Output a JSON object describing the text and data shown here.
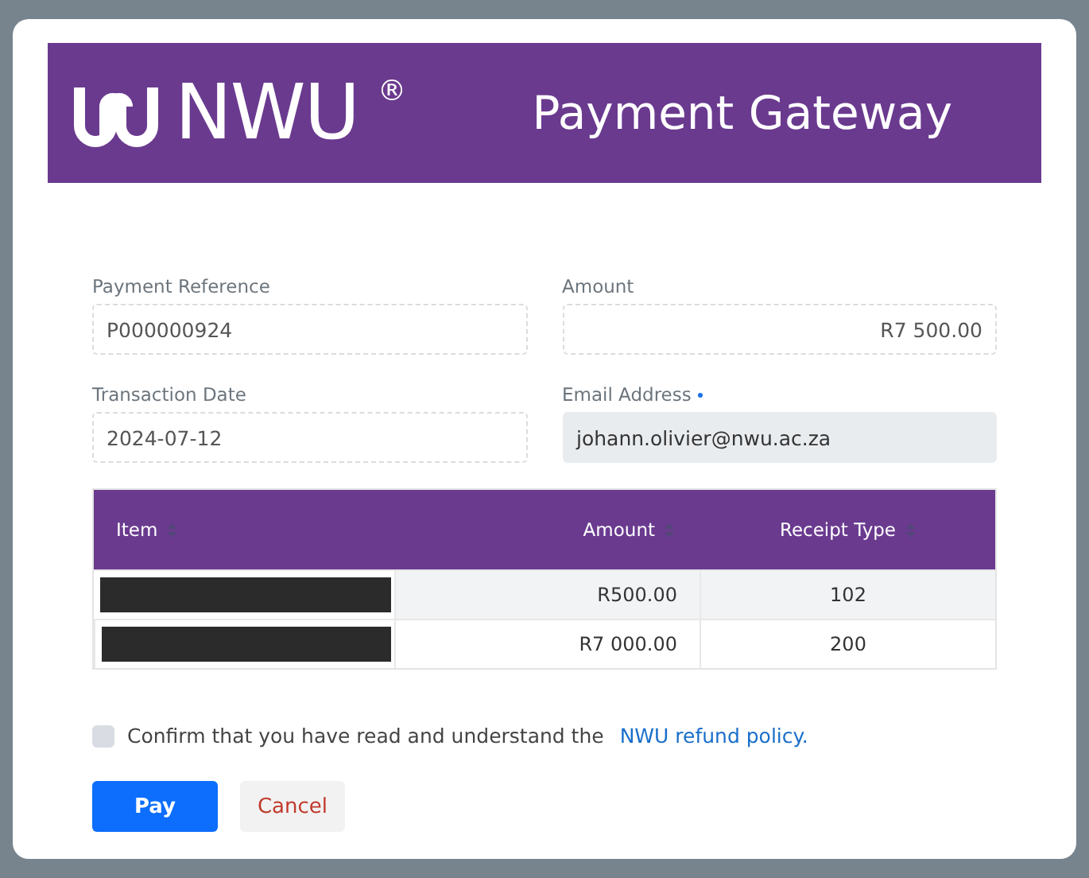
{
  "header": {
    "logo_text": "NWU",
    "logo_mark": "®",
    "title": "Payment Gateway"
  },
  "fields": [
    {
      "label": "Payment Reference",
      "value": "P000000924",
      "disabled": false,
      "required": false
    },
    {
      "label": "Amount",
      "value": "R7 500.00",
      "disabled": false,
      "required": false
    },
    {
      "label": "Transaction Date",
      "value": "2024-07-12",
      "disabled": false,
      "required": false
    },
    {
      "label": "Email Address",
      "value": "johann.olivier@nwu.ac.za",
      "disabled": true,
      "required": true
    }
  ],
  "table": {
    "columns": [
      {
        "label": "Item"
      },
      {
        "label": "Amount"
      },
      {
        "label": "Receipt Type"
      }
    ],
    "rows": [
      {
        "item_redacted": true,
        "amount": "R500.00",
        "receipt_type": "102",
        "striped": true
      },
      {
        "item_redacted": true,
        "amount": "R7 000.00",
        "receipt_type": "200",
        "striped": false
      }
    ]
  },
  "confirm": {
    "text": "Confirm that you have read and understand the",
    "link": "NWU refund policy.",
    "checked": false
  },
  "buttons": [
    {
      "label": "Pay",
      "kind": "primary"
    },
    {
      "label": "Cancel",
      "kind": "secondary"
    }
  ]
}
